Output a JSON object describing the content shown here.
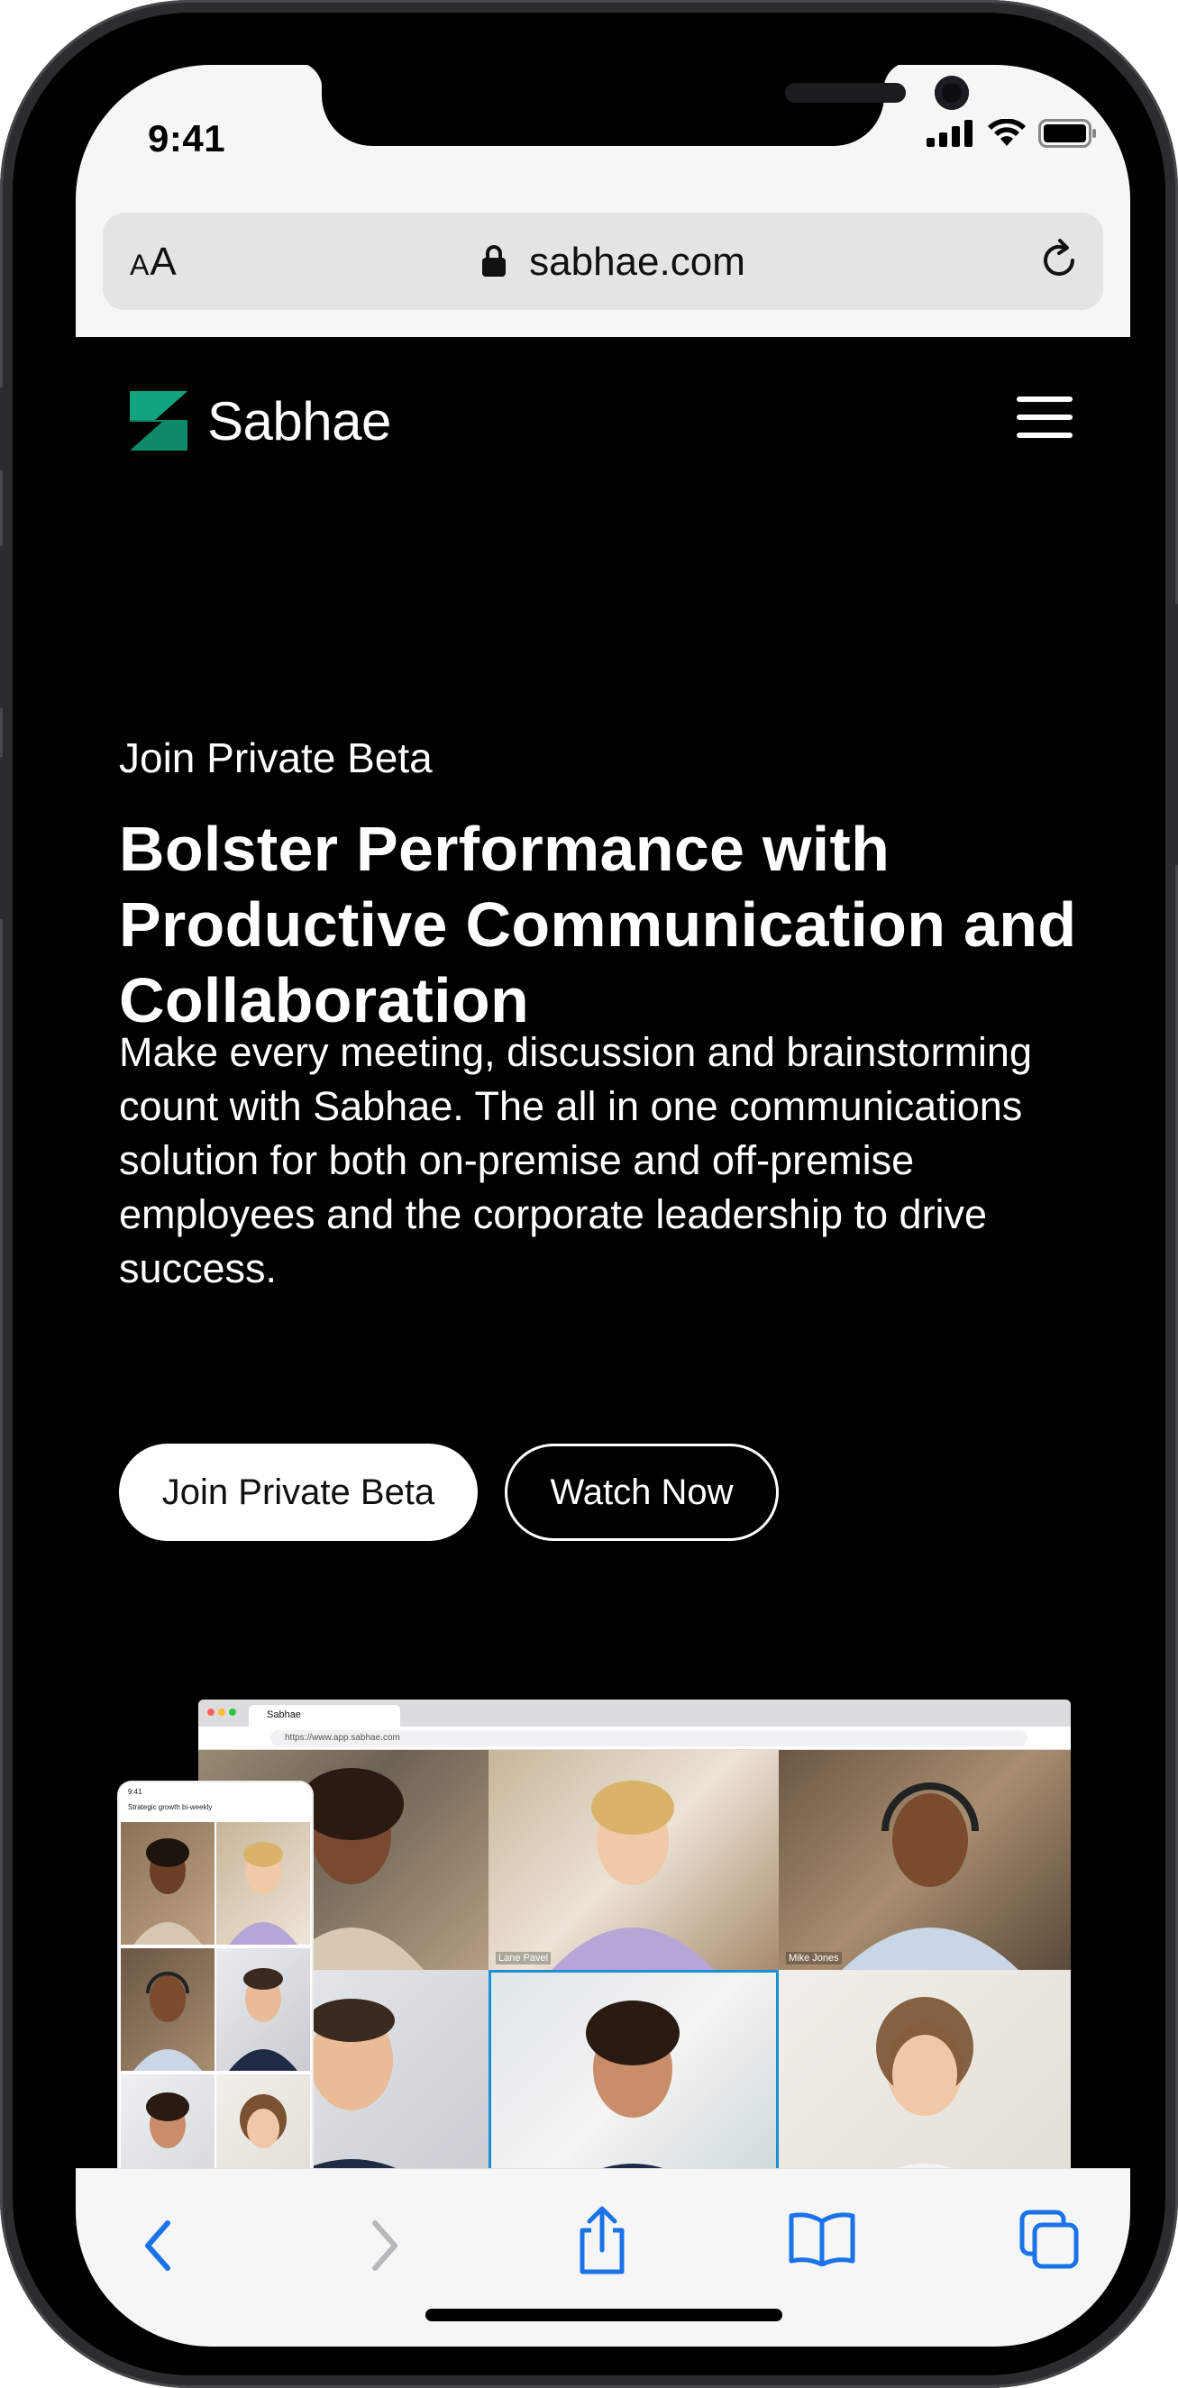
{
  "status_bar": {
    "time": "9:41"
  },
  "browser": {
    "text_size_label_small": "A",
    "text_size_label_large": "A",
    "url": "sabhae.com",
    "toolbar": {
      "back_icon": "chevron-left-icon",
      "forward_icon": "chevron-right-icon",
      "share_icon": "share-icon",
      "bookmarks_icon": "book-icon",
      "tabs_icon": "tabs-icon"
    },
    "accent_color": "#1a73e8"
  },
  "site": {
    "brand": "Sabhae",
    "brand_color": "#0e8a6a",
    "hero": {
      "eyebrow": "Join Private Beta",
      "headline": "Bolster Performance with Productive Communication and Collaboration",
      "lead": "Make every meeting, discussion and brainstorming count with Sabhae. The all in one communications solution for both on-premise and off-premise employees and the corporate leadership to drive success.",
      "primary_cta": "Join Private Beta",
      "secondary_cta": "Watch Now"
    },
    "mock": {
      "desktop_tab_title": "Sabhae",
      "desktop_url": "https://www.app.sabhae.com",
      "participants": [
        "Lane Pavel",
        "Mike Jones"
      ],
      "mobile_time": "9:41",
      "mobile_title": "Strategic growth bi-weekly"
    }
  }
}
